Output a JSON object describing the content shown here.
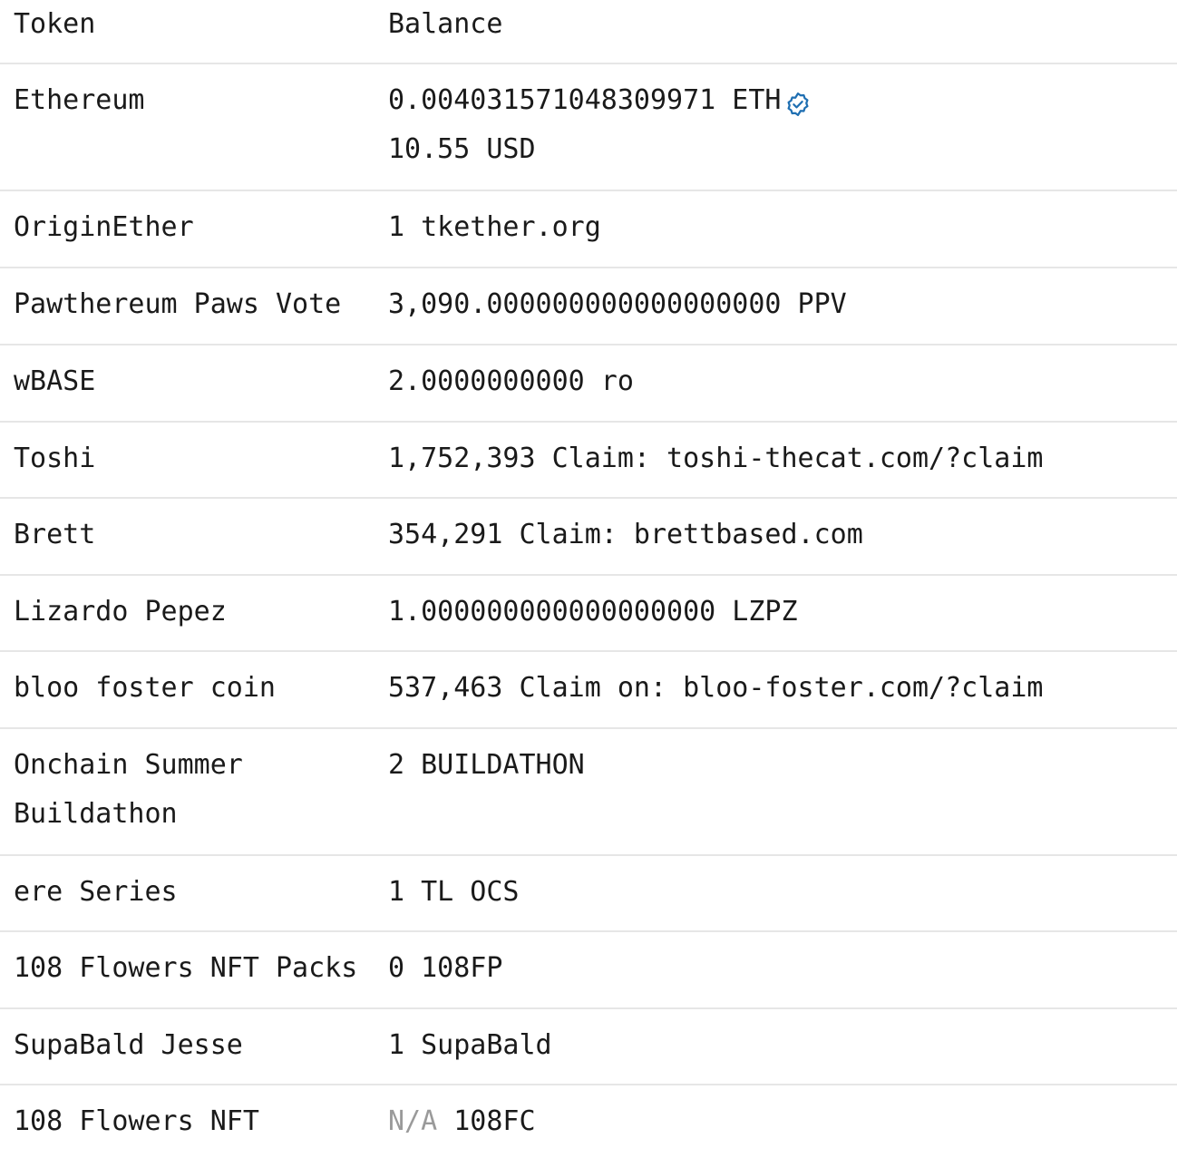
{
  "header": {
    "token": "Token",
    "balance": "Balance"
  },
  "rows": [
    {
      "token": "Ethereum",
      "balance": "0.004031571048309971 ETH",
      "balance_usd": "10.55 USD",
      "icon": "verified-badge-icon"
    },
    {
      "token": "OriginEther",
      "balance": "1 tkether.org"
    },
    {
      "token": "Pawthereum Paws Vote",
      "balance": "3,090.000000000000000000 PPV"
    },
    {
      "token": "wBASE",
      "balance": "2.0000000000 ro"
    },
    {
      "token": "Toshi",
      "balance": "1,752,393 Claim: toshi-thecat.com/?claim"
    },
    {
      "token": "Brett",
      "balance": "354,291 Claim: brettbased.com"
    },
    {
      "token": "Lizardo Pepez",
      "balance": "1.000000000000000000 LZPZ"
    },
    {
      "token": "bloo foster coin",
      "balance": "537,463 Claim on: bloo-foster.com/?claim"
    },
    {
      "token": "Onchain Summer Buildathon",
      "balance": "2 BUILDATHON"
    },
    {
      "token": "ere Series",
      "balance": "1 TL OCS"
    },
    {
      "token": "108 Flowers NFT Packs",
      "balance": "0 108FP"
    },
    {
      "token": "SupaBald Jesse",
      "balance": "1 SupaBald"
    },
    {
      "token": "108 Flowers NFT",
      "balance_amount": "N/A",
      "balance_symbol": "108FC"
    }
  ],
  "colors": {
    "divider": "#e6e6e6",
    "verified": "#1f6fb2",
    "muted": "#9a9a9a"
  }
}
